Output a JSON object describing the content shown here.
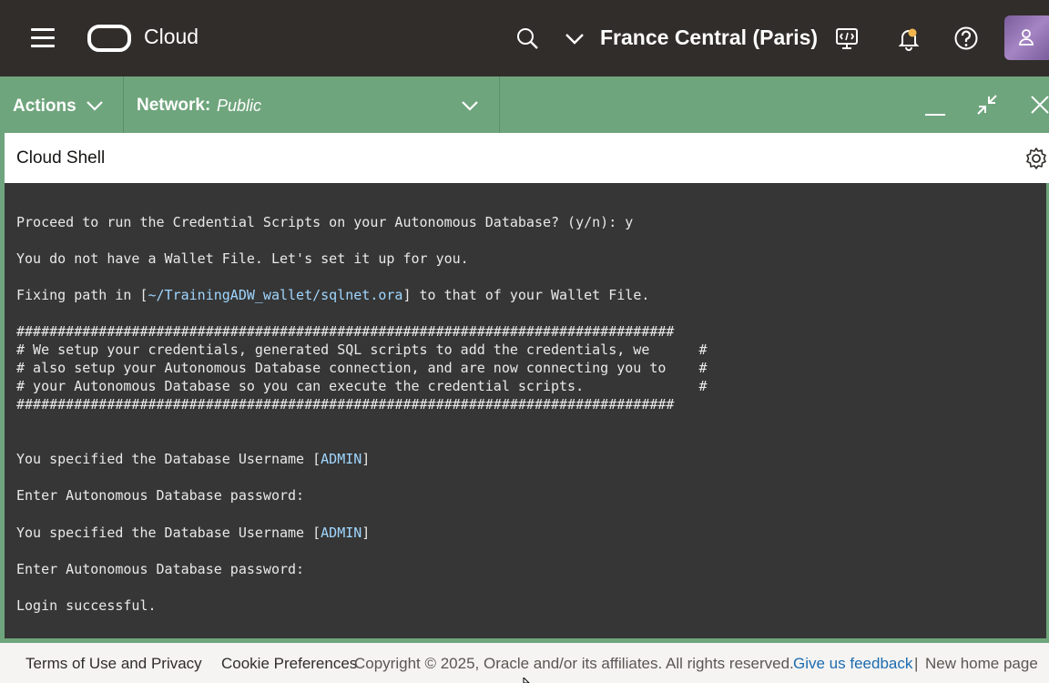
{
  "header": {
    "brand": "Cloud",
    "region": "France Central (Paris)",
    "icons": [
      "hamburger-menu-icon",
      "oracle-logo-icon",
      "search-icon",
      "chevron-down-icon",
      "cloud-shell-icon",
      "bell-icon",
      "help-icon",
      "user-icon"
    ],
    "notification_dot_color": "#f0b750"
  },
  "shell": {
    "actions_label": "Actions",
    "network_label": "Network:",
    "network_value": "Public",
    "title": "Cloud Shell",
    "bar_color": "#6fa57d"
  },
  "terminal": {
    "lines": [
      "Proceed to run the Credential Scripts on your Autonomous Database? (y/n): y",
      "You do not have a Wallet File. Let's set it up for you.",
      "Fixing path in [",
      "~/TrainingADW_wallet/sqlnet.ora",
      "] to that of your Wallet File.",
      "################################################################################",
      "# We setup your credentials, generated SQL scripts to add the credentials, we      #",
      "# also setup your Autonomous Database connection, and are now connecting you to    #",
      "# your Autonomous Database so you can execute the credential scripts.              #",
      "################################################################################",
      "You specified the Database Username [",
      "ADMIN",
      "]",
      "Enter Autonomous Database password:",
      "You specified the Database Username [",
      "ADMIN",
      "]",
      "Enter Autonomous Database password:",
      "Login successful."
    ]
  },
  "footer": {
    "terms": "Terms of Use and Privacy",
    "cookie": "Cookie Preferences",
    "copyright": "Copyright © 2025, Oracle and/or its affiliates. All rights reserved.",
    "feedback": "Give us feedback",
    "separator": "|",
    "new_home": "New home page",
    "link_color": "#1c6bb0"
  }
}
